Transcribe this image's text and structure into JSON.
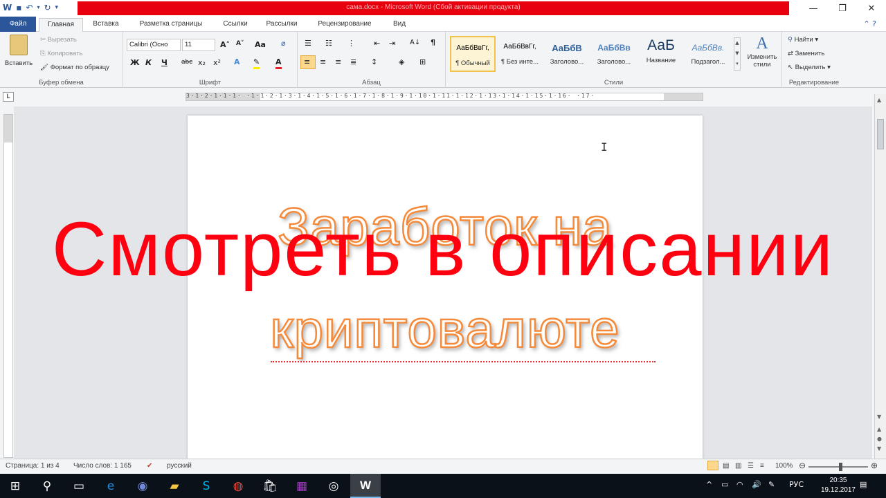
{
  "window": {
    "title": "сама.docx - Microsoft Word (Сбой активации продукта)",
    "minimize_icon": "minimize-icon",
    "maximize_icon": "restore-icon",
    "close_icon": "close-icon"
  },
  "tabs": {
    "file": "Файл",
    "home": "Главная",
    "insert": "Вставка",
    "layout": "Разметка страницы",
    "references": "Ссылки",
    "mailings": "Рассылки",
    "review": "Рецензирование",
    "view": "Вид"
  },
  "clipboard": {
    "paste": "Вставить",
    "cut": "Вырезать",
    "copy": "Копировать",
    "format_painter": "Формат по образцу",
    "label": "Буфер обмена"
  },
  "font": {
    "name": "Calibri (Осно",
    "size": "11",
    "change_case": "Аа",
    "bold": "Ж",
    "italic": "К",
    "underline": "Ч",
    "strike": "abc",
    "subscript": "x₂",
    "superscript": "x²",
    "label": "Шрифт"
  },
  "paragraph": {
    "label": "Абзац",
    "pilcrow": "¶"
  },
  "styles": {
    "label": "Стили",
    "items": [
      {
        "preview": "АаБбВвГг,",
        "name": "¶ Обычный"
      },
      {
        "preview": "АаБбВвГг,",
        "name": "¶ Без инте..."
      },
      {
        "preview": "АаБбВ",
        "name": "Заголово..."
      },
      {
        "preview": "АаБбВв",
        "name": "Заголово..."
      },
      {
        "preview": "АаБ",
        "name": "Название"
      },
      {
        "preview": "АаБбВв.",
        "name": "Подзагол..."
      }
    ],
    "change_styles_line1": "Изменить",
    "change_styles_line2": "стили"
  },
  "editing": {
    "find": "Найти",
    "replace": "Заменить",
    "select": "Выделить",
    "label": "Редактирование"
  },
  "ruler": {
    "numbers": "3·1·2·1·1·1·    ·1·1·2·1·3·1·4·1·5·1·6·1·7·1·8·1·9·1·10·1·11·1·12·1·13·1·14·1·15·1·16·    ·17·"
  },
  "document": {
    "wordart_line1": "Заработок на",
    "wordart_line2": "криптовалюте"
  },
  "overlay": {
    "text": "Смотреть в описании"
  },
  "status": {
    "page": "Страница: 1 из 4",
    "words": "Число слов: 1 165",
    "language": "русский",
    "zoom": "100%"
  },
  "taskbar": {
    "language": "РУС",
    "time": "20:35",
    "date": "19.12.2017"
  },
  "colors": {
    "accent": "#2b579a",
    "title_red": "#e8000f",
    "overlay_red": "#ff0010",
    "wordart_outline": "#f58a3a"
  }
}
